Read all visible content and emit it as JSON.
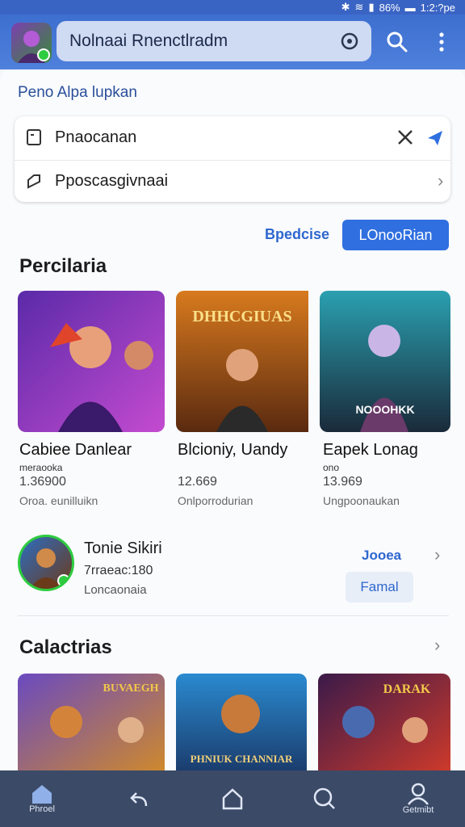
{
  "status_bar": {
    "battery": "86%",
    "time": "1:2:?pe"
  },
  "app_bar": {
    "search_text": "Nolnaai Rnenctlradm"
  },
  "hero": {
    "small_title": "Peno Alpa lupkan",
    "row1": "Pnaocanan",
    "row2": "Pposcasgivnaai"
  },
  "actions": {
    "link_label": "Bpedcise",
    "primary_label": "LOnooRian"
  },
  "section1": {
    "title": "Percilaria"
  },
  "games": [
    {
      "name": "Cabiee Danlear",
      "sub": "meraooka",
      "count": "1.36900",
      "dev": "Oroa. eunilluikn",
      "thumb_text": ""
    },
    {
      "name": "Blcioniy, Uandy",
      "sub": "",
      "count": "12.669",
      "dev": "Onlporrodurian",
      "thumb_text": "DHHCGIUAS"
    },
    {
      "name": "Eapek Lonag",
      "sub": "ono",
      "count": "13.969",
      "dev": "Ungpoonaukan",
      "thumb_text": "NOOOHKK"
    }
  ],
  "profile": {
    "name": "Tonie Sikiri",
    "code": "7rraeac:180",
    "sub": "Loncaonaia",
    "link": "Jooea",
    "button": "Famal"
  },
  "section2": {
    "title": "Calactrias"
  },
  "games2": [
    {
      "thumb_text": "BUVAEGH"
    },
    {
      "thumb_text": "PHNIUK CHANNIAR"
    },
    {
      "thumb_text": "DARAK"
    }
  ],
  "nav": [
    {
      "label": "Phroel",
      "icon": "home-icon"
    },
    {
      "label": "",
      "icon": "back-icon"
    },
    {
      "label": "",
      "icon": "house-icon"
    },
    {
      "label": "",
      "icon": "search-icon"
    },
    {
      "label": "Getmibt",
      "icon": "profile-icon"
    }
  ],
  "colors": {
    "primary": "#2f6fe0",
    "app_bar": "#3d6fd0",
    "nav": "#3b4a66",
    "accent_green": "#2ecc40"
  }
}
